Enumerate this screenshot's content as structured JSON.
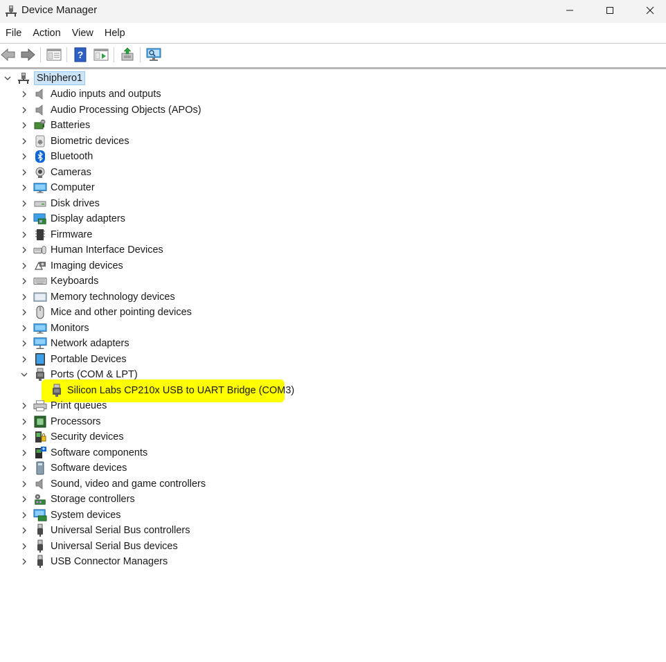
{
  "window": {
    "title": "Device Manager",
    "controls": {
      "minimize": "minimize",
      "maximize": "maximize",
      "close": "close"
    }
  },
  "menu": [
    "File",
    "Action",
    "View",
    "Help"
  ],
  "toolbar": {
    "buttons": [
      "back-arrow-icon",
      "forward-arrow-icon",
      "show-hide-console-tree-icon",
      "help-icon",
      "properties-icon",
      "update-driver-icon",
      "scan-hardware-icon"
    ]
  },
  "tree": {
    "root": "Shiphero1",
    "categories": [
      {
        "label": "Audio inputs and outputs",
        "icon": "speaker-icon"
      },
      {
        "label": "Audio Processing Objects (APOs)",
        "icon": "speaker-icon"
      },
      {
        "label": "Batteries",
        "icon": "battery-icon"
      },
      {
        "label": "Biometric devices",
        "icon": "fingerprint-icon"
      },
      {
        "label": "Bluetooth",
        "icon": "bluetooth-icon"
      },
      {
        "label": "Cameras",
        "icon": "camera-icon"
      },
      {
        "label": "Computer",
        "icon": "monitor-icon"
      },
      {
        "label": "Disk drives",
        "icon": "disk-drive-icon"
      },
      {
        "label": "Display adapters",
        "icon": "display-adapter-icon"
      },
      {
        "label": "Firmware",
        "icon": "firmware-chip-icon"
      },
      {
        "label": "Human Interface Devices",
        "icon": "hid-icon"
      },
      {
        "label": "Imaging devices",
        "icon": "imaging-icon"
      },
      {
        "label": "Keyboards",
        "icon": "keyboard-icon"
      },
      {
        "label": "Memory technology devices",
        "icon": "memory-card-icon"
      },
      {
        "label": "Mice and other pointing devices",
        "icon": "mouse-icon"
      },
      {
        "label": "Monitors",
        "icon": "monitor-icon"
      },
      {
        "label": "Network adapters",
        "icon": "network-icon"
      },
      {
        "label": "Portable Devices",
        "icon": "portable-device-icon"
      },
      {
        "label": "Ports (COM & LPT)",
        "icon": "port-icon",
        "expanded": true,
        "children": [
          {
            "label": "Silicon Labs CP210x USB to UART Bridge (COM3)",
            "icon": "port-icon",
            "highlighted": true
          }
        ]
      },
      {
        "label": "Print queues",
        "icon": "printer-icon"
      },
      {
        "label": "Processors",
        "icon": "processor-icon"
      },
      {
        "label": "Security devices",
        "icon": "security-device-icon"
      },
      {
        "label": "Software components",
        "icon": "software-component-icon"
      },
      {
        "label": "Software devices",
        "icon": "software-device-icon"
      },
      {
        "label": "Sound, video and game controllers",
        "icon": "speaker-icon"
      },
      {
        "label": "Storage controllers",
        "icon": "storage-controller-icon"
      },
      {
        "label": "System devices",
        "icon": "system-devices-icon"
      },
      {
        "label": "Universal Serial Bus controllers",
        "icon": "usb-icon"
      },
      {
        "label": "Universal Serial Bus devices",
        "icon": "usb-icon"
      },
      {
        "label": "USB Connector Managers",
        "icon": "usb-icon"
      }
    ]
  },
  "colors": {
    "highlight": "#ffff00",
    "selection": "#cce4f7",
    "accent_blue": "#0078d4"
  }
}
